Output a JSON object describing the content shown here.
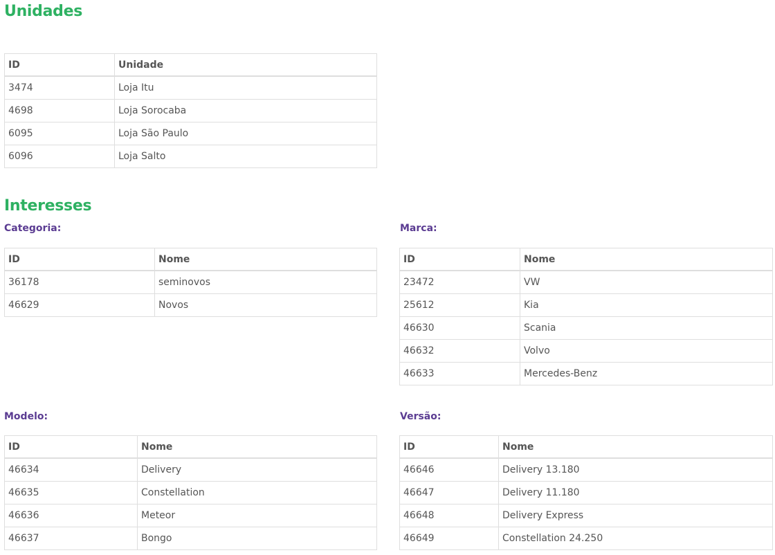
{
  "unidades": {
    "title": "Unidades",
    "headers": [
      "ID",
      "Unidade"
    ],
    "rows": [
      [
        "3474",
        "Loja Itu"
      ],
      [
        "4698",
        "Loja Sorocaba"
      ],
      [
        "6095",
        "Loja São Paulo"
      ],
      [
        "6096",
        "Loja Salto"
      ]
    ]
  },
  "interesses": {
    "title": "Interesses",
    "categoria": {
      "label": "Categoria:",
      "headers": [
        "ID",
        "Nome"
      ],
      "rows": [
        [
          "36178",
          "seminovos"
        ],
        [
          "46629",
          "Novos"
        ]
      ]
    },
    "marca": {
      "label": "Marca:",
      "headers": [
        "ID",
        "Nome"
      ],
      "rows": [
        [
          "23472",
          "VW"
        ],
        [
          "25612",
          "Kia"
        ],
        [
          "46630",
          "Scania"
        ],
        [
          "46632",
          "Volvo"
        ],
        [
          "46633",
          "Mercedes-Benz"
        ]
      ]
    },
    "modelo": {
      "label": "Modelo:",
      "headers": [
        "ID",
        "Nome"
      ],
      "rows": [
        [
          "46634",
          "Delivery"
        ],
        [
          "46635",
          "Constellation"
        ],
        [
          "46636",
          "Meteor"
        ],
        [
          "46637",
          "Bongo"
        ]
      ]
    },
    "versao": {
      "label": "Versão:",
      "headers": [
        "ID",
        "Nome"
      ],
      "rows": [
        [
          "46646",
          "Delivery 13.180"
        ],
        [
          "46647",
          "Delivery 11.180"
        ],
        [
          "46648",
          "Delivery Express"
        ],
        [
          "46649",
          "Constellation 24.250"
        ]
      ]
    }
  },
  "colors": {
    "heading_green": "#2eb162",
    "subheading_purple": "#5b3c92",
    "text_gray": "#555555",
    "border_gray": "#dedede"
  }
}
